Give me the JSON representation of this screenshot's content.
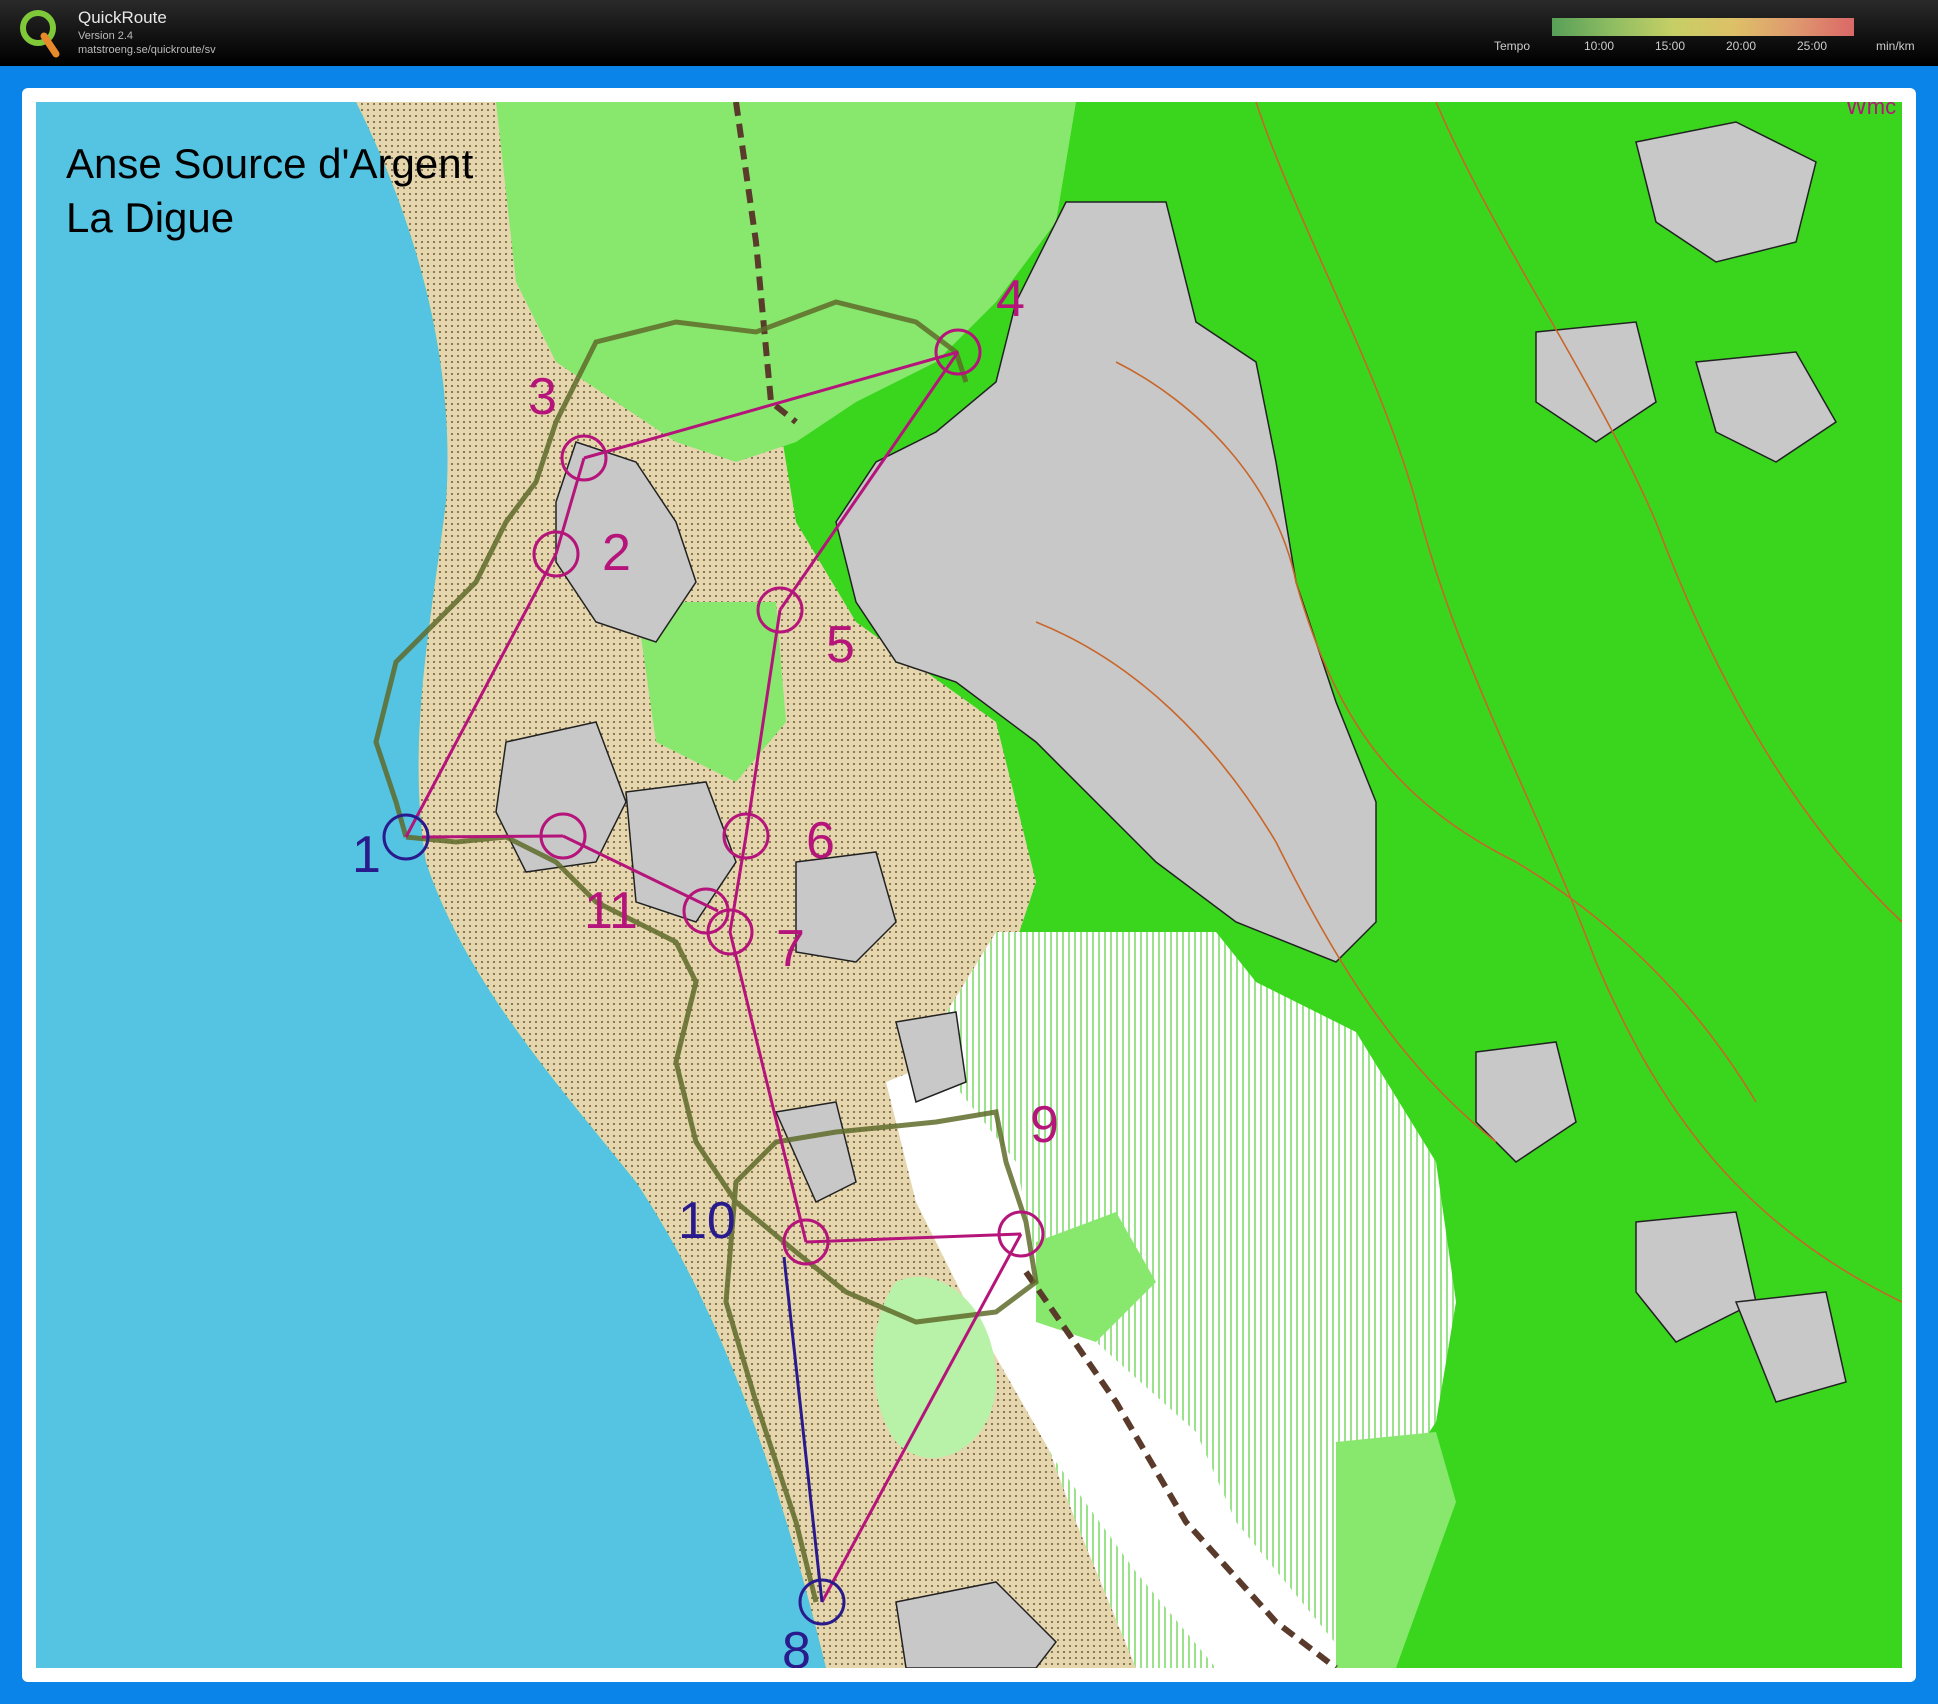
{
  "app": {
    "name": "QuickRoute",
    "version": "Version 2.4",
    "url": "matstroeng.se/quickroute/sv"
  },
  "tempo_scale": {
    "label": "Tempo",
    "ticks": [
      "10:00",
      "15:00",
      "20:00",
      "25:00"
    ],
    "unit": "min/km"
  },
  "map": {
    "title_line1": "Anse Source d'Argent",
    "title_line2": "La Digue",
    "corner_text": "Wmc",
    "controls": [
      {
        "label": "1",
        "color": "#2a1b8c"
      },
      {
        "label": "2",
        "color": "#b5157a"
      },
      {
        "label": "3",
        "color": "#b5157a"
      },
      {
        "label": "4",
        "color": "#b5157a"
      },
      {
        "label": "5",
        "color": "#b5157a"
      },
      {
        "label": "6",
        "color": "#b5157a"
      },
      {
        "label": "7",
        "color": "#b5157a"
      },
      {
        "label": "8",
        "color": "#2a1b8c"
      },
      {
        "label": "9",
        "color": "#b5157a"
      },
      {
        "label": "10",
        "color": "#2a1b8c"
      },
      {
        "label": "11",
        "color": "#b5157a"
      }
    ],
    "colors": {
      "water": "#54c4e2",
      "sand": "#e3d2a8",
      "rock": "#c8c8c8",
      "forest_dark": "#3ad61e",
      "forest_light": "#88e86e",
      "open": "#ffffff",
      "course": "#b5157a",
      "route": "#6a5a2a"
    }
  }
}
